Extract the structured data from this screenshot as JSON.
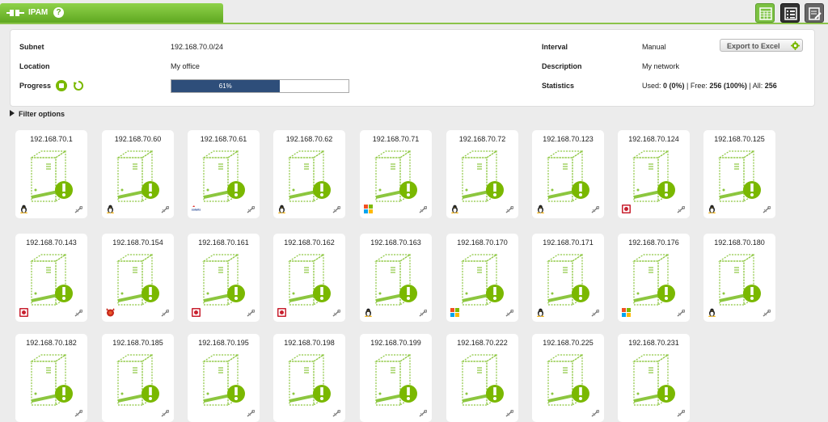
{
  "tab": {
    "title": "IPAM",
    "help": "?"
  },
  "header": {
    "subnet_label": "Subnet",
    "subnet_value": "192.168.70.0/24",
    "location_label": "Location",
    "location_value": "My office",
    "progress_label": "Progress",
    "progress_text": "61%",
    "progress_fraction": 0.61,
    "interval_label": "Interval",
    "interval_value": "Manual",
    "description_label": "Description",
    "description_value": "My network",
    "statistics_label": "Statistics",
    "stats_used_label": "Used: ",
    "stats_used_value": "0 (0%)",
    "stats_free_label": " | Free: ",
    "stats_free_value": "256 (100%)",
    "stats_all_label": " | All: ",
    "stats_all_value": "256",
    "export_label": "Export to Excel"
  },
  "filter": {
    "label": "Filter options"
  },
  "colors": {
    "accent": "#7ab800",
    "tab_green": "#6cb82c",
    "progress": "#2e4e7a",
    "alert": "#7ab800"
  },
  "hosts": [
    {
      "ip": "192.168.70.1",
      "os": "linux"
    },
    {
      "ip": "192.168.70.60",
      "os": "linux"
    },
    {
      "ip": "192.168.70.61",
      "os": "solaris"
    },
    {
      "ip": "192.168.70.62",
      "os": "linux"
    },
    {
      "ip": "192.168.70.71",
      "os": "windows"
    },
    {
      "ip": "192.168.70.72",
      "os": "linux"
    },
    {
      "ip": "192.168.70.123",
      "os": "linux"
    },
    {
      "ip": "192.168.70.124",
      "os": "redbox"
    },
    {
      "ip": "192.168.70.125",
      "os": "linux"
    },
    {
      "ip": "192.168.70.143",
      "os": "redbox"
    },
    {
      "ip": "192.168.70.154",
      "os": "bsd"
    },
    {
      "ip": "192.168.70.161",
      "os": "redbox"
    },
    {
      "ip": "192.168.70.162",
      "os": "redbox"
    },
    {
      "ip": "192.168.70.163",
      "os": "linux"
    },
    {
      "ip": "192.168.70.170",
      "os": "windows"
    },
    {
      "ip": "192.168.70.171",
      "os": "linux"
    },
    {
      "ip": "192.168.70.176",
      "os": "windows"
    },
    {
      "ip": "192.168.70.180",
      "os": "linux"
    },
    {
      "ip": "192.168.70.182",
      "os": ""
    },
    {
      "ip": "192.168.70.185",
      "os": ""
    },
    {
      "ip": "192.168.70.195",
      "os": ""
    },
    {
      "ip": "192.168.70.198",
      "os": ""
    },
    {
      "ip": "192.168.70.199",
      "os": ""
    },
    {
      "ip": "192.168.70.222",
      "os": ""
    },
    {
      "ip": "192.168.70.225",
      "os": ""
    },
    {
      "ip": "192.168.70.231",
      "os": ""
    }
  ]
}
